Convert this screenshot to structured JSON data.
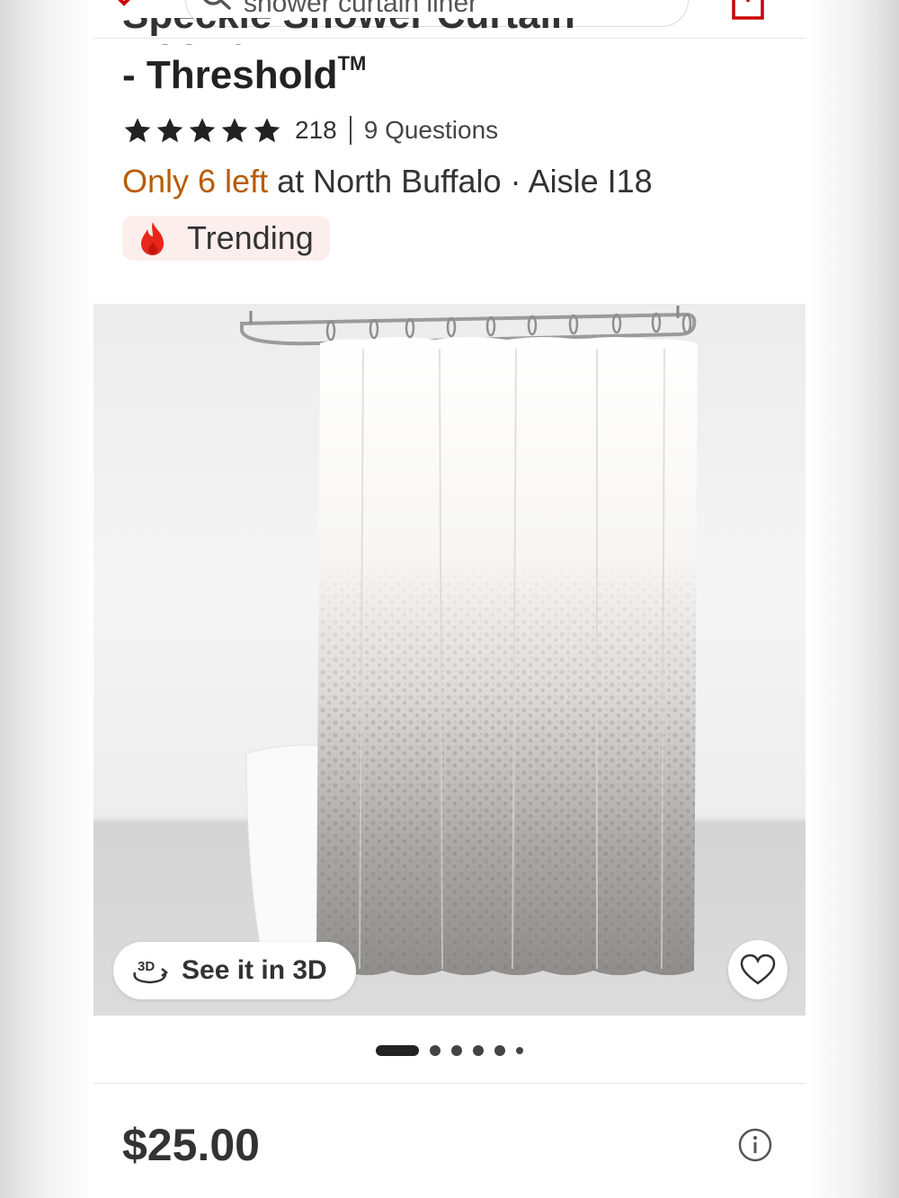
{
  "search": {
    "query": "shower curtain liner"
  },
  "product": {
    "title_line_partial": "Speckle Shower Curtain White/Gray",
    "title_line": "- Threshold",
    "trademark": "TM",
    "rating": {
      "stars": 5,
      "count": "218",
      "questions": "9 Questions"
    },
    "stock": {
      "low_text": "Only 6 left",
      "store_text": "at North Buffalo · Aisle I18"
    },
    "badge": {
      "label": "Trending"
    },
    "gallery": {
      "see_3d_label": "See it in 3D",
      "dots": 6,
      "active_dot": 1
    },
    "price": "$25.00"
  },
  "colors": {
    "brand_red": "#cc0000",
    "stock_orange": "#b85c00",
    "badge_bg": "#fdeeee"
  },
  "icons": [
    "back-arrow-icon",
    "search-icon",
    "share-icon",
    "star-icon",
    "flame-icon",
    "3d-icon",
    "heart-icon",
    "info-icon"
  ]
}
